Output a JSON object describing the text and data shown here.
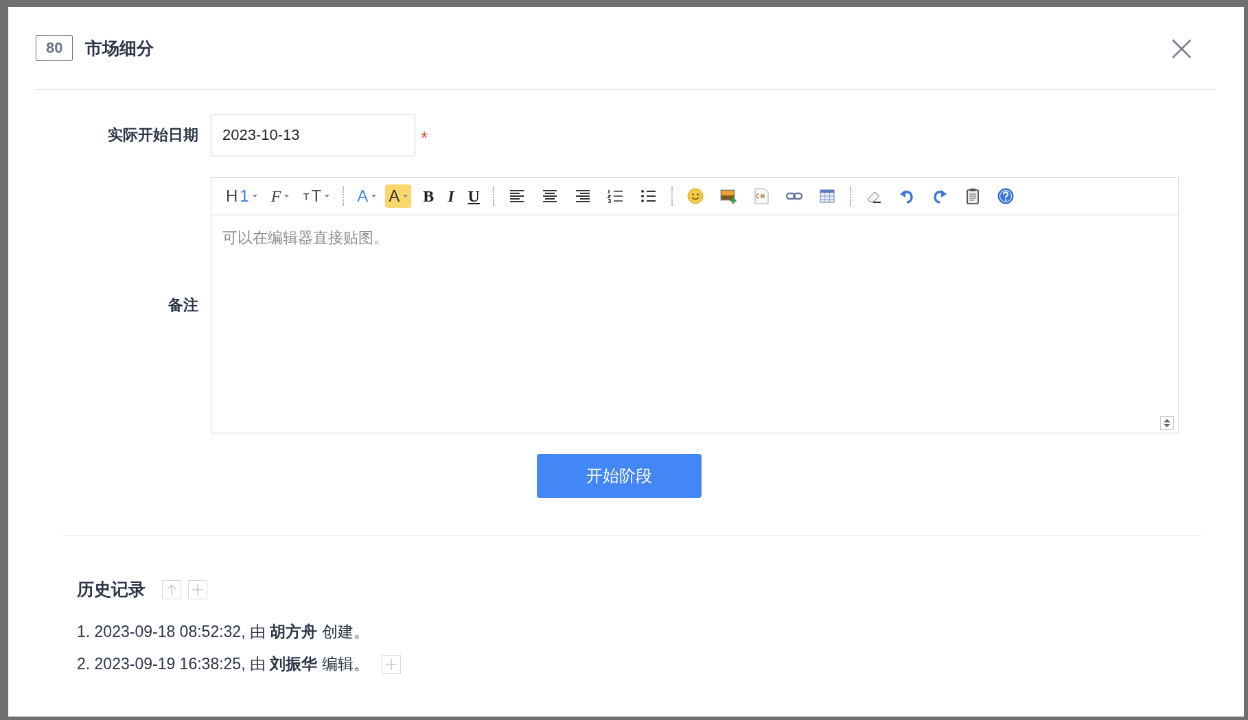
{
  "dialog": {
    "badge": "80",
    "title": "市场细分",
    "close_icon": "×"
  },
  "form": {
    "start_date": {
      "label": "实际开始日期",
      "value": "2023-10-13",
      "required": true,
      "required_mark": "*"
    },
    "notes": {
      "label": "备注",
      "placeholder": "可以在编辑器直接贴图。",
      "toolbar": [
        {
          "kind": "heading",
          "label": "H",
          "accent": "1",
          "dropdown": true
        },
        {
          "kind": "font",
          "label": "F",
          "dropdown": true
        },
        {
          "kind": "size",
          "small": "T",
          "label": "T",
          "dropdown": true
        },
        {
          "kind": "separator"
        },
        {
          "kind": "color",
          "label": "A",
          "dropdown": true
        },
        {
          "kind": "highlight",
          "label": "A",
          "dropdown": true
        },
        {
          "kind": "bold",
          "label": "B",
          "dropdown": false
        },
        {
          "kind": "italic",
          "label": "I",
          "dropdown": false
        },
        {
          "kind": "underline",
          "label": "U",
          "dropdown": false
        },
        {
          "kind": "separator"
        },
        {
          "kind": "align-left"
        },
        {
          "kind": "align-center"
        },
        {
          "kind": "align-right"
        },
        {
          "kind": "ordered-list"
        },
        {
          "kind": "bullet-list"
        },
        {
          "kind": "separator"
        },
        {
          "kind": "emoji"
        },
        {
          "kind": "image"
        },
        {
          "kind": "code"
        },
        {
          "kind": "link"
        },
        {
          "kind": "table"
        },
        {
          "kind": "separator"
        },
        {
          "kind": "eraser"
        },
        {
          "kind": "undo"
        },
        {
          "kind": "redo"
        },
        {
          "kind": "paste"
        },
        {
          "kind": "help"
        }
      ]
    },
    "submit": "开始阶段"
  },
  "history": {
    "title": "历史记录",
    "entries": [
      {
        "text": "1. 2023-09-18 08:52:32, 由 **胡方舟** 创建。",
        "add_button": false
      },
      {
        "text": "2. 2023-09-19 16:38:25, 由 **刘振华** 编辑。",
        "add_button": true
      }
    ]
  }
}
